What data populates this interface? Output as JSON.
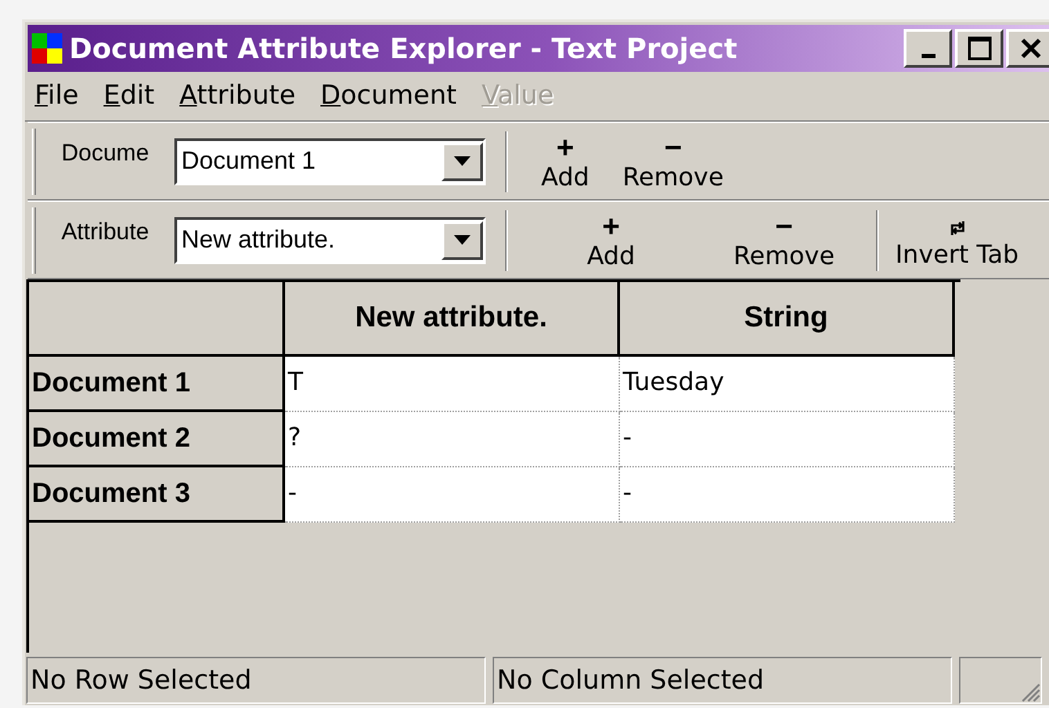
{
  "window": {
    "title": "Document Attribute Explorer - Text Project"
  },
  "menu": [
    {
      "underlined": "F",
      "rest": "ile",
      "disabled": false
    },
    {
      "underlined": "E",
      "rest": "dit",
      "disabled": false
    },
    {
      "underlined": "A",
      "rest": "ttribute",
      "disabled": false
    },
    {
      "underlined": "D",
      "rest": "ocument",
      "disabled": false
    },
    {
      "underlined": "V",
      "rest": "alue",
      "disabled": true
    }
  ],
  "toolbars": [
    {
      "label": "Docume",
      "combo_value": "Document 1",
      "buttons": [
        {
          "kind": "add",
          "glyph": "+",
          "label": "Add"
        },
        {
          "kind": "remove",
          "glyph": "−",
          "label": "Remove"
        }
      ]
    },
    {
      "label": "Attribute",
      "combo_value": "New attribute.",
      "buttons": [
        {
          "kind": "add",
          "glyph": "+",
          "label": "Add"
        },
        {
          "kind": "remove",
          "glyph": "−",
          "label": "Remove"
        },
        {
          "kind": "invert",
          "label": "Invert Tab"
        }
      ]
    }
  ],
  "table": {
    "columns": [
      "New attribute.",
      "String"
    ],
    "rows": [
      {
        "header": "Document 1",
        "cells": [
          "T",
          "Tuesday"
        ]
      },
      {
        "header": "Document 2",
        "cells": [
          "?",
          "-"
        ]
      },
      {
        "header": "Document 3",
        "cells": [
          "-",
          "-"
        ]
      }
    ]
  },
  "status_bar": [
    "No Row Selected",
    "No Column Selected"
  ]
}
